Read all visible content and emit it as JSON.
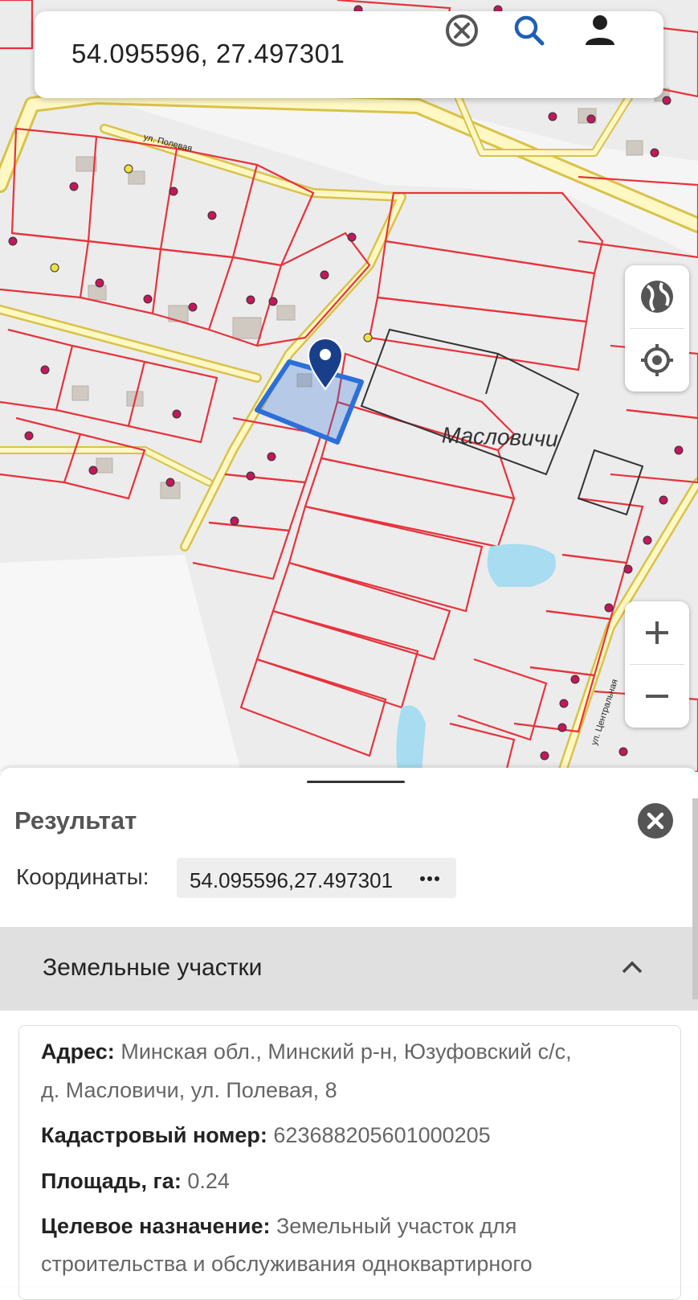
{
  "search": {
    "query": "54.095596, 27.497301",
    "clear_icon": "clear-circle-icon",
    "search_icon": "search-icon",
    "account_icon": "account-icon"
  },
  "map": {
    "village_label": "Масловичи",
    "street_poleva": "ул. Полевая",
    "street_central": "ул. Центральная",
    "controls": {
      "layers_icon": "globe-icon",
      "locate_icon": "my-location-icon",
      "zoom_in": "+",
      "zoom_out": "−"
    },
    "colors": {
      "parcel_line": "#e8323c",
      "road_fill": "#fff8c4",
      "road_edge": "#d9c24a",
      "selection": "#2c6fd8",
      "water": "#a8dcf0"
    }
  },
  "result": {
    "title": "Результат",
    "close_icon": "close-icon",
    "coord_label": "Координаты:",
    "coord_value": "54.095596,27.497301",
    "more_icon": "more-horiz-icon",
    "section_title": "Земельные участки",
    "section_icon": "chevron-up-icon",
    "parcel": {
      "address_label": "Адрес:",
      "address_line1": "Минская обл., Минский р-н, Юзуфовский с/с,",
      "address_line2": "д. Масловичи, ул. Полевая, 8",
      "cadastral_label": "Кадастровый номер:",
      "cadastral_value": "623688205601000205",
      "area_label": "Площадь, га:",
      "area_value": "0.24",
      "purpose_label": "Целевое назначение:",
      "purpose_line1": "Земельный участок для",
      "purpose_line2": "строительства и обслуживания одноквартирного"
    }
  }
}
